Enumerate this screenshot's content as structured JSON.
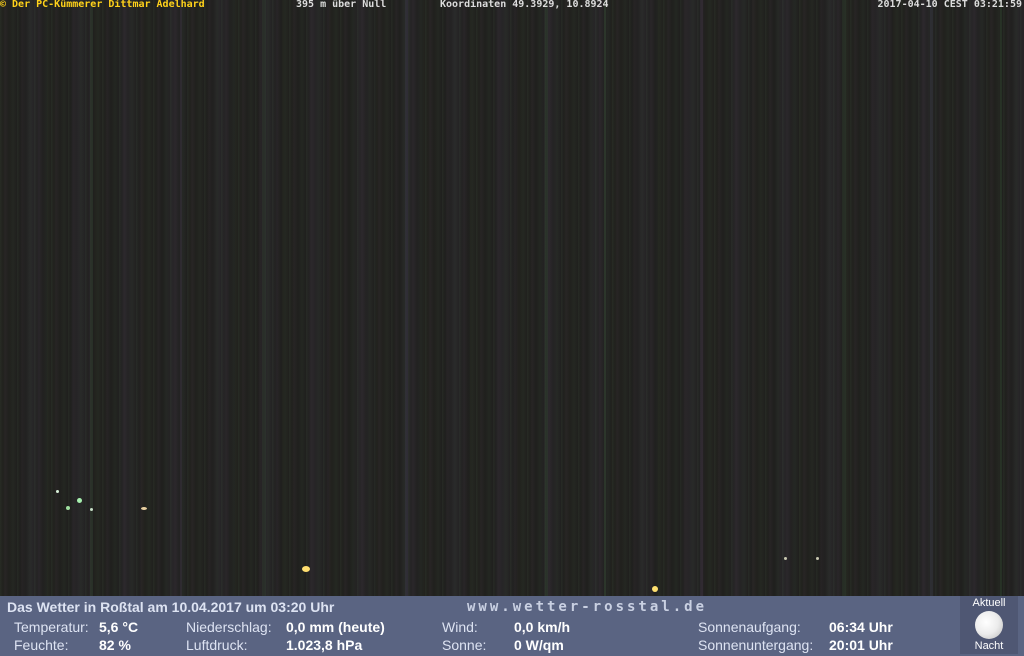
{
  "overlay": {
    "credit": "© Der PC-Kümmerer Dittmar Adelhard",
    "elevation": "395 m über Null",
    "coordinates": "Koordinaten 49.3929, 10.8924",
    "timestamp": "2017-04-10 CEST 03:21:59"
  },
  "panel": {
    "title": "Das Wetter in Roßtal am 10.04.2017 um 03:20 Uhr",
    "site": "www.wetter-rosstal.de",
    "temperature": {
      "label": "Temperatur:",
      "value": "5,6 °C"
    },
    "humidity": {
      "label": "Feuchte:",
      "value": "82 %"
    },
    "precipitation": {
      "label": "Niederschlag:",
      "value": "0,0 mm (heute)"
    },
    "pressure": {
      "label": "Luftdruck:",
      "value": "1.023,8 hPa"
    },
    "wind": {
      "label": "Wind:",
      "value": "0,0 km/h"
    },
    "sun": {
      "label": "Sonne:",
      "value": "0 W/qm"
    },
    "sunrise": {
      "label": "Sonnenaufgang:",
      "value": "06:34 Uhr"
    },
    "sunset": {
      "label": "Sonnenuntergang:",
      "value": "20:01 Uhr"
    },
    "moon": {
      "top_label": "Aktuell",
      "bottom_label": "Nacht",
      "icon": "full-moon-icon"
    }
  },
  "colors": {
    "panel_bg": "#5a6482",
    "credit_text": "#ffd21a",
    "overlay_text": "#dcdcdc"
  }
}
